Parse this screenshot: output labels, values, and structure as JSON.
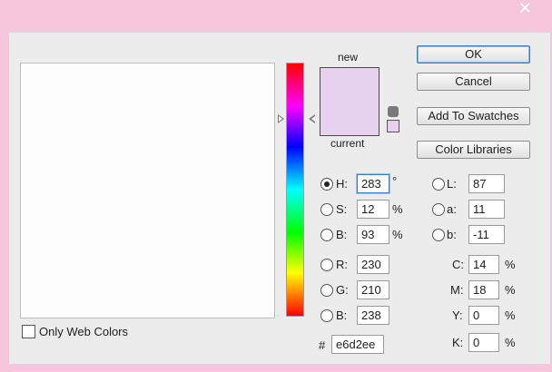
{
  "window": {
    "close_glyph": "✕"
  },
  "swatch": {
    "new_label": "new",
    "current_label": "current",
    "new_color": "#e6d2ee",
    "current_color": "#e6d2ee"
  },
  "buttons": {
    "ok": "OK",
    "cancel": "Cancel",
    "add_to_swatches": "Add To Swatches",
    "color_libraries": "Color Libraries"
  },
  "hsb": [
    {
      "label": "H:",
      "value": "283",
      "unit": "°",
      "checked": true
    },
    {
      "label": "S:",
      "value": "12",
      "unit": "%",
      "checked": false
    },
    {
      "label": "B:",
      "value": "93",
      "unit": "%",
      "checked": false
    }
  ],
  "rgb": [
    {
      "label": "R:",
      "value": "230"
    },
    {
      "label": "G:",
      "value": "210"
    },
    {
      "label": "B:",
      "value": "238"
    }
  ],
  "lab": [
    {
      "label": "L:",
      "value": "87"
    },
    {
      "label": "a:",
      "value": "11"
    },
    {
      "label": "b:",
      "value": "-11"
    }
  ],
  "cmyk": [
    {
      "label": "C:",
      "value": "14",
      "unit": "%"
    },
    {
      "label": "M:",
      "value": "18",
      "unit": "%"
    },
    {
      "label": "Y:",
      "value": "0",
      "unit": "%"
    },
    {
      "label": "K:",
      "value": "0",
      "unit": "%"
    }
  ],
  "hex": {
    "label": "#",
    "value": "e6d2ee"
  },
  "only_web_colors": {
    "label": "Only Web Colors",
    "checked": false
  },
  "colors": {
    "background": "#f6c6dc",
    "dialog": "#ececec",
    "accent": "#3d7cc9"
  }
}
